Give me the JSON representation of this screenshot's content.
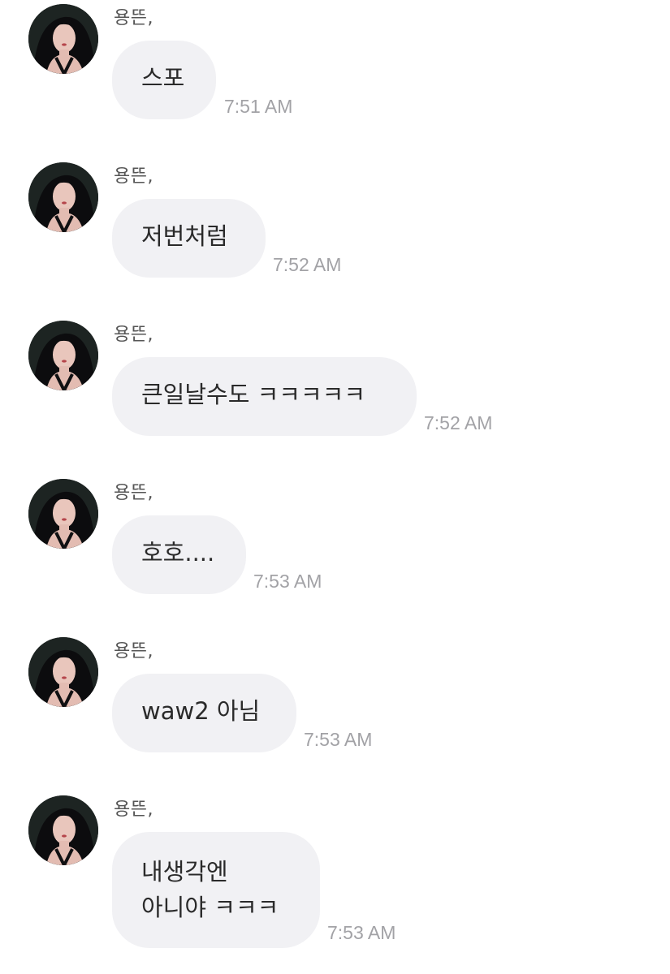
{
  "messages": [
    {
      "sender": "용뜬,",
      "text": "스포",
      "time": "7:51 AM"
    },
    {
      "sender": "용뜬,",
      "text": "저번처럼",
      "time": "7:52 AM"
    },
    {
      "sender": "용뜬,",
      "text": "큰일날수도 ㅋㅋㅋㅋㅋ",
      "time": "7:52 AM"
    },
    {
      "sender": "용뜬,",
      "text": "호호....",
      "time": "7:53 AM"
    },
    {
      "sender": "용뜬,",
      "text": "waw2 아님",
      "time": "7:53 AM"
    },
    {
      "sender": "용뜬,",
      "text": "내생각엔\n아니야 ㅋㅋㅋ",
      "time": "7:53 AM"
    }
  ]
}
